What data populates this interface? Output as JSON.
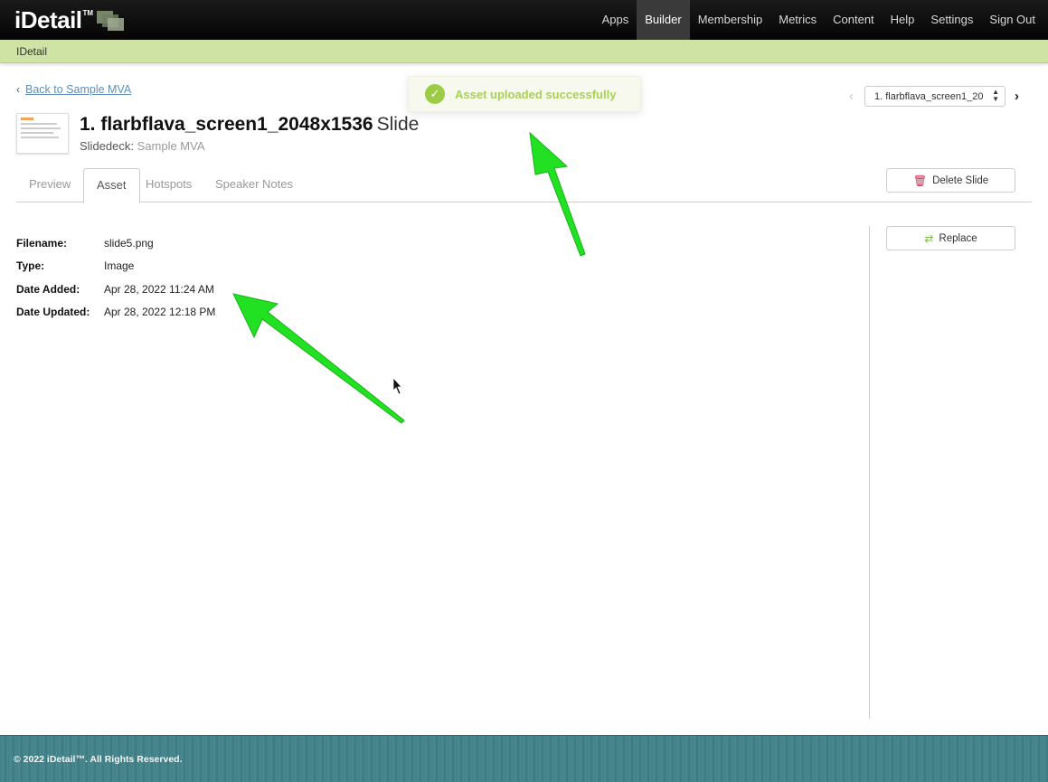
{
  "brand": {
    "name": "iDetail",
    "tm": "TM",
    "colors": {
      "accent": "#cfe3a4",
      "success": "#9ccb45",
      "footer": "#437f85",
      "annotation_arrow": "#1fdc1f"
    }
  },
  "nav": {
    "items": [
      "Apps",
      "Builder",
      "Membership",
      "Metrics",
      "Content",
      "Help",
      "Settings",
      "Sign Out"
    ],
    "active": "Builder"
  },
  "subbar": {
    "label": "IDetail"
  },
  "back": {
    "label": "Back to Sample MVA"
  },
  "toast": {
    "message": "Asset uploaded successfully",
    "icon": "check-circle-icon"
  },
  "pager": {
    "selected": "1. flarbflava_screen1_20"
  },
  "slide": {
    "number": "1.",
    "name": "flarbflava_screen1_2048x1536",
    "kind": "Slide",
    "deck_prefix": "Slidedeck:",
    "deck_name": "Sample MVA"
  },
  "tabs": [
    {
      "label": "Preview"
    },
    {
      "label": "Asset",
      "active": true
    },
    {
      "label": "Hotspots"
    },
    {
      "label": "Speaker Notes"
    }
  ],
  "buttons": {
    "delete": "Delete Slide",
    "replace": "Replace"
  },
  "asset": {
    "fields": [
      {
        "label": "Filename:",
        "value": "slide5.png"
      },
      {
        "label": "Type:",
        "value": "Image"
      },
      {
        "label": "Date Added:",
        "value": "Apr 28, 2022 11:24 AM"
      },
      {
        "label": "Date Updated:",
        "value": "Apr 28, 2022 12:18 PM"
      }
    ]
  },
  "footer": {
    "text": "© 2022 iDetail™.  All Rights Reserved."
  }
}
